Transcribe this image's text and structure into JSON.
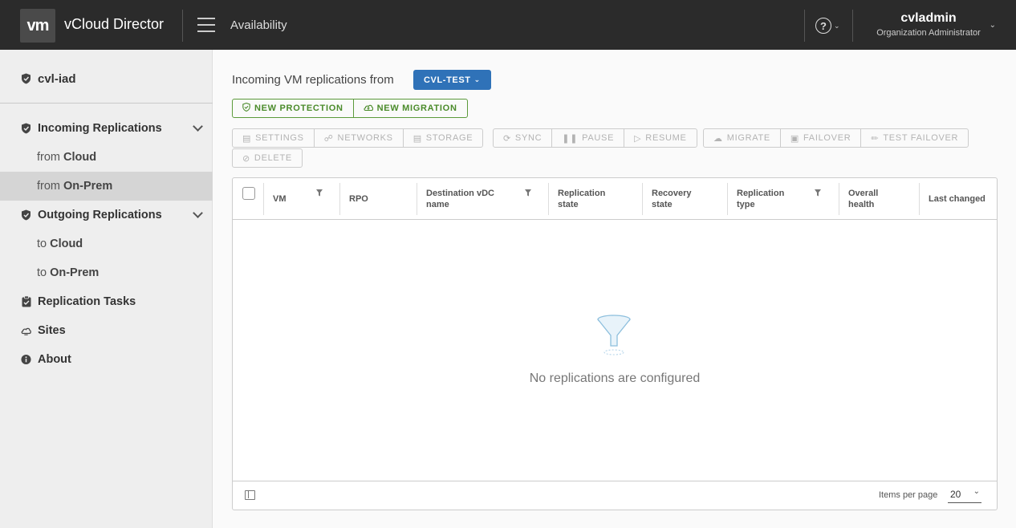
{
  "header": {
    "logo": "vm",
    "app_title": "vCloud Director",
    "section": "Availability",
    "help_glyph": "?",
    "user_name": "cvladmin",
    "user_role": "Organization Administrator"
  },
  "sidebar": {
    "site": "cvl-iad",
    "incoming": {
      "label": "Incoming Replications",
      "items": [
        {
          "prefix": "from",
          "target": "Cloud",
          "active": false
        },
        {
          "prefix": "from",
          "target": "On-Prem",
          "active": true
        }
      ]
    },
    "outgoing": {
      "label": "Outgoing Replications",
      "items": [
        {
          "prefix": "to",
          "target": "Cloud",
          "active": false
        },
        {
          "prefix": "to",
          "target": "On-Prem",
          "active": false
        }
      ]
    },
    "tasks": "Replication Tasks",
    "sites": "Sites",
    "about": "About"
  },
  "main": {
    "incoming_label": "Incoming VM replications from",
    "org_dropdown": "CVL-TEST",
    "actions": {
      "new_protection": "NEW PROTECTION",
      "new_migration": "NEW MIGRATION"
    },
    "toolbar": {
      "settings": "SETTINGS",
      "networks": "NETWORKS",
      "storage": "STORAGE",
      "sync": "SYNC",
      "pause": "PAUSE",
      "resume": "RESUME",
      "migrate": "MIGRATE",
      "failover": "FAILOVER",
      "test_failover": "TEST FAILOVER",
      "delete": "DELETE"
    },
    "grid": {
      "columns": [
        {
          "line1": "VM",
          "line2": ""
        },
        {
          "line1": "RPO",
          "line2": ""
        },
        {
          "line1": "Destination vDC",
          "line2": "name"
        },
        {
          "line1": "Replication",
          "line2": "state"
        },
        {
          "line1": "Recovery",
          "line2": "state"
        },
        {
          "line1": "Replication",
          "line2": "type"
        },
        {
          "line1": "Overall",
          "line2": "health"
        },
        {
          "line1": "Last changed",
          "line2": ""
        }
      ],
      "empty_message": "No replications are configured",
      "items_per_page_label": "Items per page",
      "items_per_page": "20"
    }
  },
  "colors": {
    "header_bg": "#2b2b2b",
    "primary": "#2f72b8",
    "success": "#4a8b2a"
  }
}
